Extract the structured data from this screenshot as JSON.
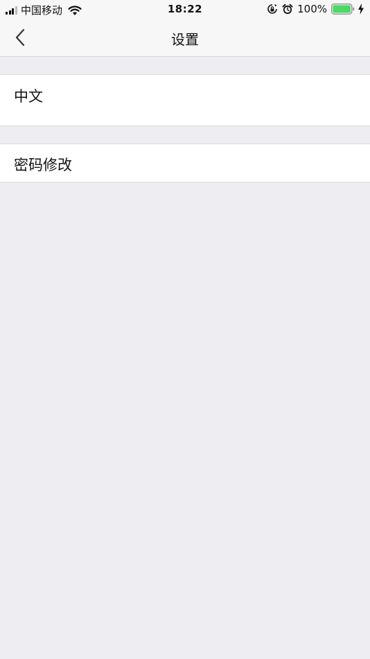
{
  "status_bar": {
    "carrier": "中国移动",
    "time": "18:22",
    "battery_percent": "100%",
    "battery_level": 1.0,
    "icons": [
      "signal-icon",
      "wifi-icon",
      "rotation-lock-icon",
      "alarm-icon",
      "battery-icon",
      "charging-bolt-icon"
    ]
  },
  "nav": {
    "title": "设置",
    "back_icon": "chevron-left-icon"
  },
  "settings": {
    "items": [
      {
        "label": "中文"
      },
      {
        "label": "密码修改"
      }
    ]
  },
  "colors": {
    "background": "#ededf2",
    "bar_background": "#f7f7f7",
    "row_background": "#ffffff",
    "separator": "#dcdcdc",
    "battery_fill": "#4cd964"
  }
}
